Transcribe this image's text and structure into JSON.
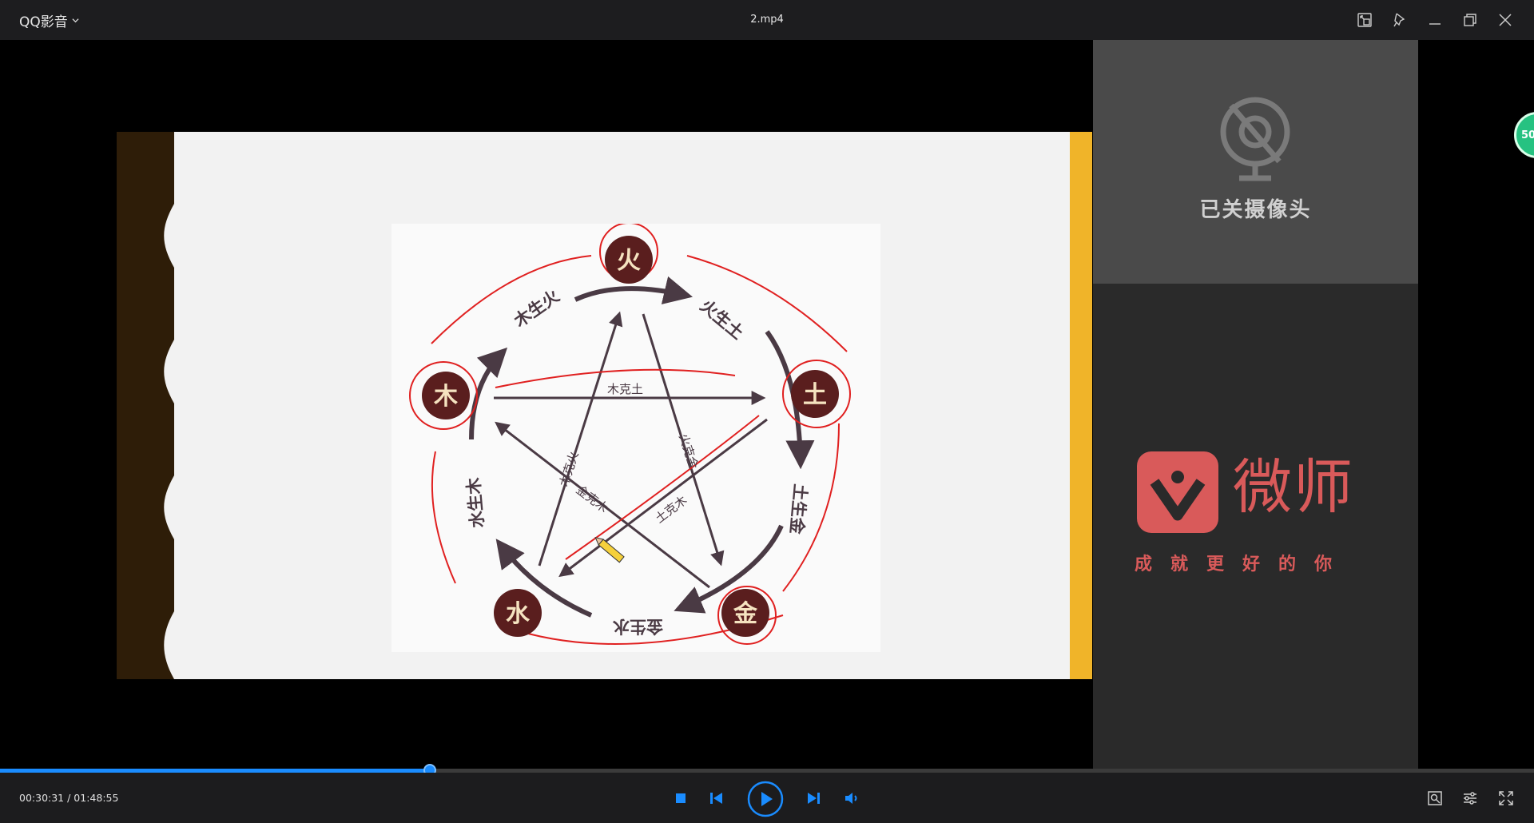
{
  "app": {
    "menu_label": "QQ影音",
    "file_name": "2.mp4"
  },
  "slide": {
    "elements": [
      "火",
      "土",
      "金",
      "水",
      "木"
    ],
    "generating": [
      "木生火",
      "火生土",
      "土生金",
      "金生水",
      "水生木"
    ],
    "overcoming": [
      "木克土",
      "木克火",
      "火克金",
      "土克木",
      "金克木"
    ]
  },
  "camera": {
    "status_text": "已关摄像头"
  },
  "brand": {
    "name": "微师",
    "slogan": "成就更好的你",
    "color": "#d95a5a"
  },
  "badge": {
    "label": "50"
  },
  "playback": {
    "current_time": "00:30:31",
    "total_time": "01:48:55",
    "time_display": "00:30:31 / 01:48:55",
    "progress_fraction": 0.28
  },
  "colors": {
    "accent": "#1a8cff",
    "titlebar": "#1d1d1f",
    "element_fill": "#5a1e1e"
  },
  "icons": {
    "titlebar": [
      "mini-mode-icon",
      "pin-icon",
      "minimize-icon",
      "restore-icon",
      "close-icon"
    ],
    "controls": [
      "stop-icon",
      "previous-icon",
      "play-icon",
      "next-icon",
      "volume-icon",
      "screenshot-icon",
      "settings-icon",
      "fullscreen-icon"
    ]
  }
}
